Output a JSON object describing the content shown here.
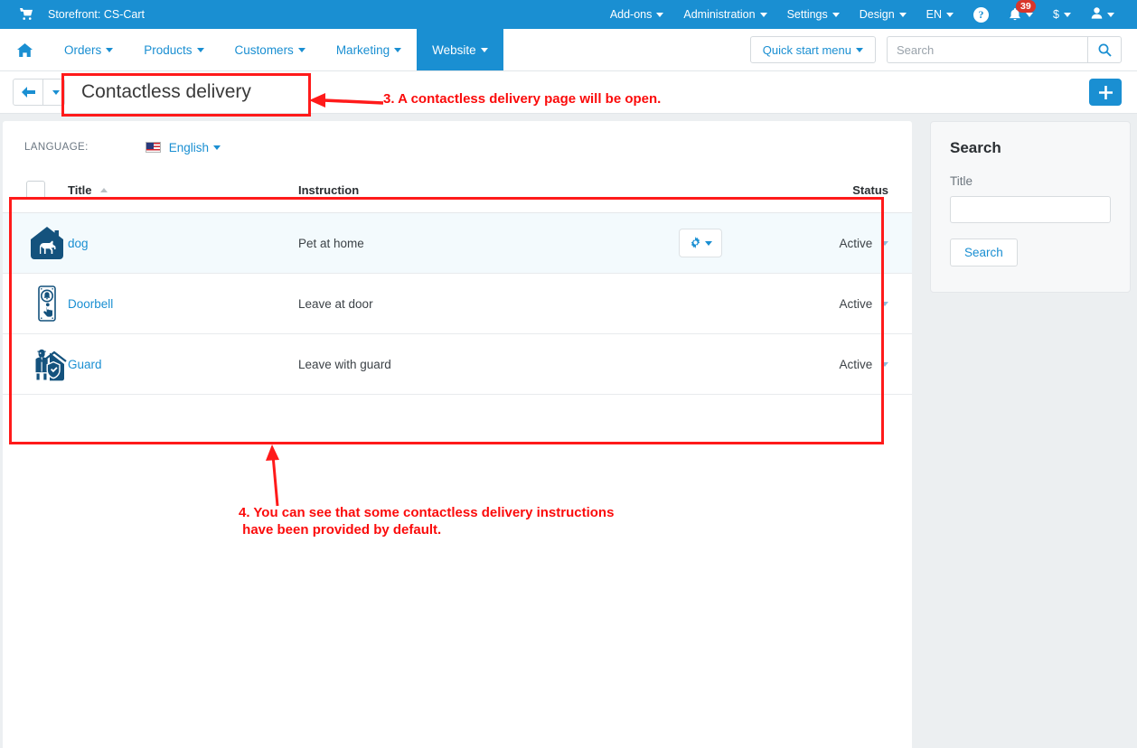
{
  "topbar": {
    "cart_icon": "cart-icon",
    "storefront": "Storefront: CS-Cart",
    "menus": [
      {
        "label": "Add-ons"
      },
      {
        "label": "Administration"
      },
      {
        "label": "Settings"
      },
      {
        "label": "Design"
      },
      {
        "label": "EN"
      }
    ],
    "help_glyph": "?",
    "notifications_count": "39",
    "currency": "$"
  },
  "mainnav": {
    "home_icon": "home-icon",
    "items": [
      {
        "label": "Orders",
        "active": false
      },
      {
        "label": "Products",
        "active": false
      },
      {
        "label": "Customers",
        "active": false
      },
      {
        "label": "Marketing",
        "active": false
      },
      {
        "label": "Website",
        "active": true
      }
    ],
    "quick_start_label": "Quick start menu",
    "search_placeholder": "Search",
    "search_value": ""
  },
  "titlebar": {
    "page_title": "Contactless delivery",
    "add_label": "+"
  },
  "language": {
    "label": "LANGUAGE:",
    "selected": "English",
    "flag": "us-flag-icon"
  },
  "table": {
    "columns": {
      "title": "Title",
      "instruction": "Instruction",
      "status": "Status"
    },
    "rows": [
      {
        "icon": "dog-house-icon",
        "title": "dog",
        "instruction": "Pet at home",
        "status": "Active",
        "highlighted": true,
        "tools": true
      },
      {
        "icon": "doorbell-icon",
        "title": "Doorbell",
        "instruction": "Leave at door",
        "status": "Active",
        "highlighted": false,
        "tools": false
      },
      {
        "icon": "guard-house-icon",
        "title": "Guard",
        "instruction": "Leave with guard",
        "status": "Active",
        "highlighted": false,
        "tools": false
      }
    ]
  },
  "sidebar": {
    "search_title": "Search",
    "title_field_label": "Title",
    "title_field_value": "",
    "search_button": "Search"
  },
  "annotations": [
    {
      "id": "note-3",
      "text": "3. A contactless delivery page will be open."
    },
    {
      "id": "note-4",
      "text": "4. You can see that some contactless delivery instructions\n have been provided by default."
    }
  ],
  "colors": {
    "brand_blue": "#1a8fd2",
    "annotation_red": "#fb0b0b",
    "badge_red": "#d9362b",
    "icon_navy": "#14527d"
  }
}
